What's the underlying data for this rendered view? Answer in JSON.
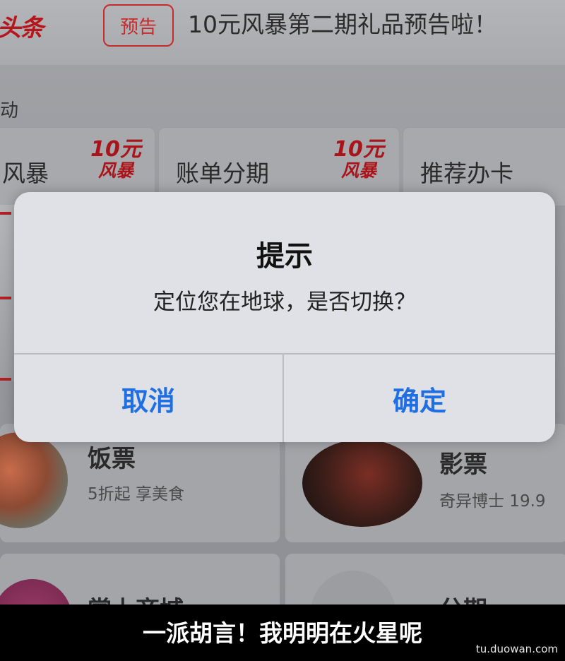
{
  "background": {
    "brand": "头条",
    "tag": "预告",
    "headline": "10元风暴第二期礼品预告啦！",
    "section_label": "动",
    "cards": [
      {
        "label": "风暴",
        "logo_top": "10元",
        "logo_bottom": "风暴"
      },
      {
        "label": "账单分期",
        "logo_top": "10元",
        "logo_bottom": "风暴"
      },
      {
        "label": "推荐办卡"
      }
    ],
    "lower_cards": [
      {
        "title": "饭票",
        "subtitle": "5折起 享美食"
      },
      {
        "title": "影票",
        "subtitle": "奇异博士 19.9"
      },
      {
        "title": "掌上商城"
      },
      {
        "title": "分期"
      }
    ]
  },
  "alert": {
    "title": "提示",
    "message": "定位您在地球，是否切换？",
    "cancel_label": "取消",
    "confirm_label": "确定"
  },
  "caption": {
    "text": "一派胡言！我明明在火星呢",
    "watermark": "tu.duowan.com"
  },
  "colors": {
    "alert_button": "#1f6fe3",
    "brand_red": "#b5161b",
    "caption_bg": "#000000"
  }
}
